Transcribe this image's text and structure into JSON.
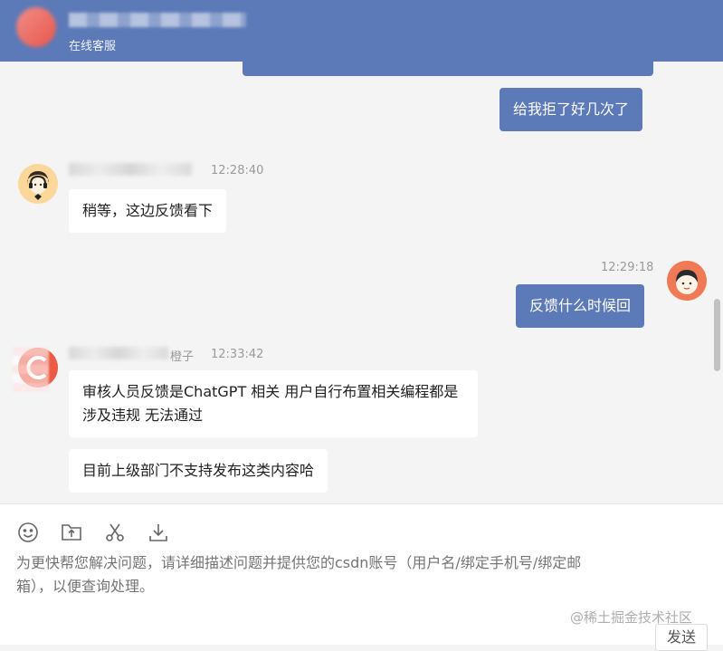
{
  "header": {
    "subtitle": "在线客服"
  },
  "messages": [
    {
      "text": "给我拒了好几次了"
    },
    {
      "time": "12:28:40",
      "text": "稍等，这边反馈看下"
    },
    {
      "time": "12:29:18",
      "text": "反馈什么时候回"
    },
    {
      "name_tail": "橙子",
      "time": "12:33:42",
      "text": "审核人员反馈是ChatGPT 相关 用户自行布置相关编程都是涉及违规 无法通过"
    },
    {
      "text": "目前上级部门不支持发布这类内容哈"
    }
  ],
  "composer": {
    "toolbar_icons": [
      "emoji-icon",
      "upload-file-icon",
      "screenshot-scissors-icon",
      "download-icon"
    ],
    "placeholder": "为更快帮您解决问题，请详细描述问题并提供您的csdn账号（用户名/绑定手机号/绑定邮箱），以便查询处理。",
    "send_label": "发送"
  },
  "watermark": "@稀土掘金技术社区",
  "colors": {
    "header": "#5c7ab8",
    "outgoing_bubble": "#5c7ab8",
    "background": "#f4f4f4"
  }
}
